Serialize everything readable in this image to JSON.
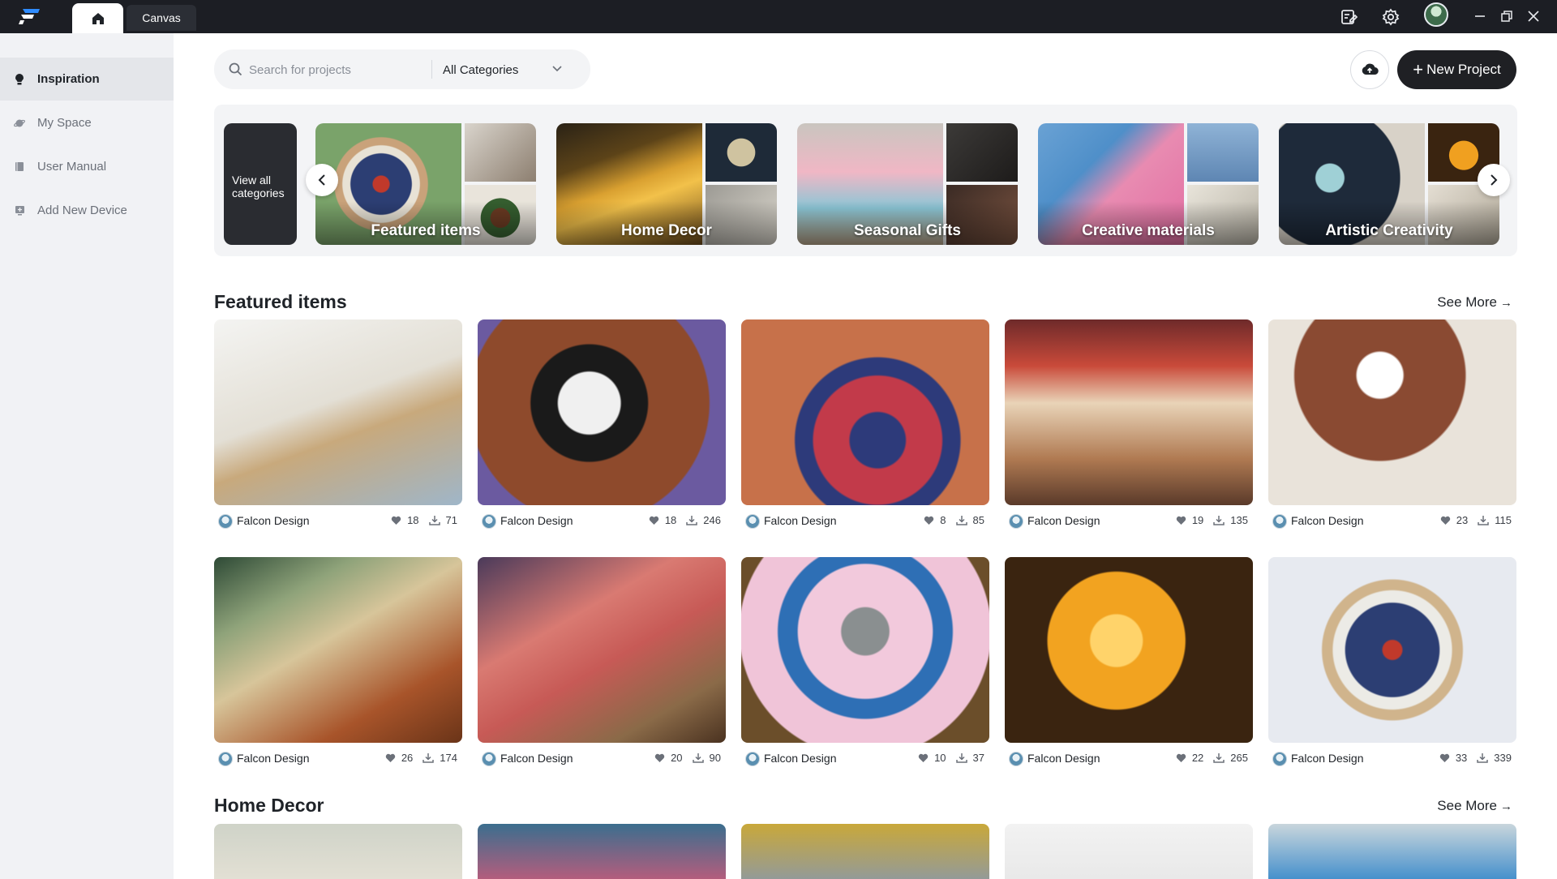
{
  "app": {
    "home_tab_label": "",
    "canvas_tab_label": "Canvas"
  },
  "sidebar": {
    "items": [
      {
        "label": "Inspiration",
        "icon": "lightbulb-icon",
        "active": true
      },
      {
        "label": "My Space",
        "icon": "planet-icon",
        "active": false
      },
      {
        "label": "User Manual",
        "icon": "book-icon",
        "active": false
      },
      {
        "label": "Add New Device",
        "icon": "add-device-icon",
        "active": false
      }
    ]
  },
  "search": {
    "placeholder": "Search for projects",
    "value": "",
    "category": "All Categories"
  },
  "toolbar": {
    "new_project_label": "New Project"
  },
  "categories": {
    "view_all_label": "View all categories",
    "items": [
      {
        "label": "Featured items"
      },
      {
        "label": "Home Decor"
      },
      {
        "label": "Seasonal Gifts"
      },
      {
        "label": "Creative materials"
      },
      {
        "label": "Artistic Creativity"
      }
    ]
  },
  "featured": {
    "title": "Featured items",
    "see_more": "See More",
    "items": [
      {
        "author": "Falcon Design",
        "likes": "18",
        "downloads": "71"
      },
      {
        "author": "Falcon Design",
        "likes": "18",
        "downloads": "246"
      },
      {
        "author": "Falcon Design",
        "likes": "8",
        "downloads": "85"
      },
      {
        "author": "Falcon Design",
        "likes": "19",
        "downloads": "135"
      },
      {
        "author": "Falcon Design",
        "likes": "23",
        "downloads": "115"
      },
      {
        "author": "Falcon Design",
        "likes": "26",
        "downloads": "174"
      },
      {
        "author": "Falcon Design",
        "likes": "20",
        "downloads": "90"
      },
      {
        "author": "Falcon Design",
        "likes": "10",
        "downloads": "37"
      },
      {
        "author": "Falcon Design",
        "likes": "22",
        "downloads": "265"
      },
      {
        "author": "Falcon Design",
        "likes": "33",
        "downloads": "339"
      }
    ]
  },
  "home_decor": {
    "title": "Home Decor",
    "see_more": "See More"
  },
  "colors": {
    "titlebar": "#1c1e24",
    "sidebar": "#f1f2f5",
    "primary_button": "#1f2024"
  }
}
